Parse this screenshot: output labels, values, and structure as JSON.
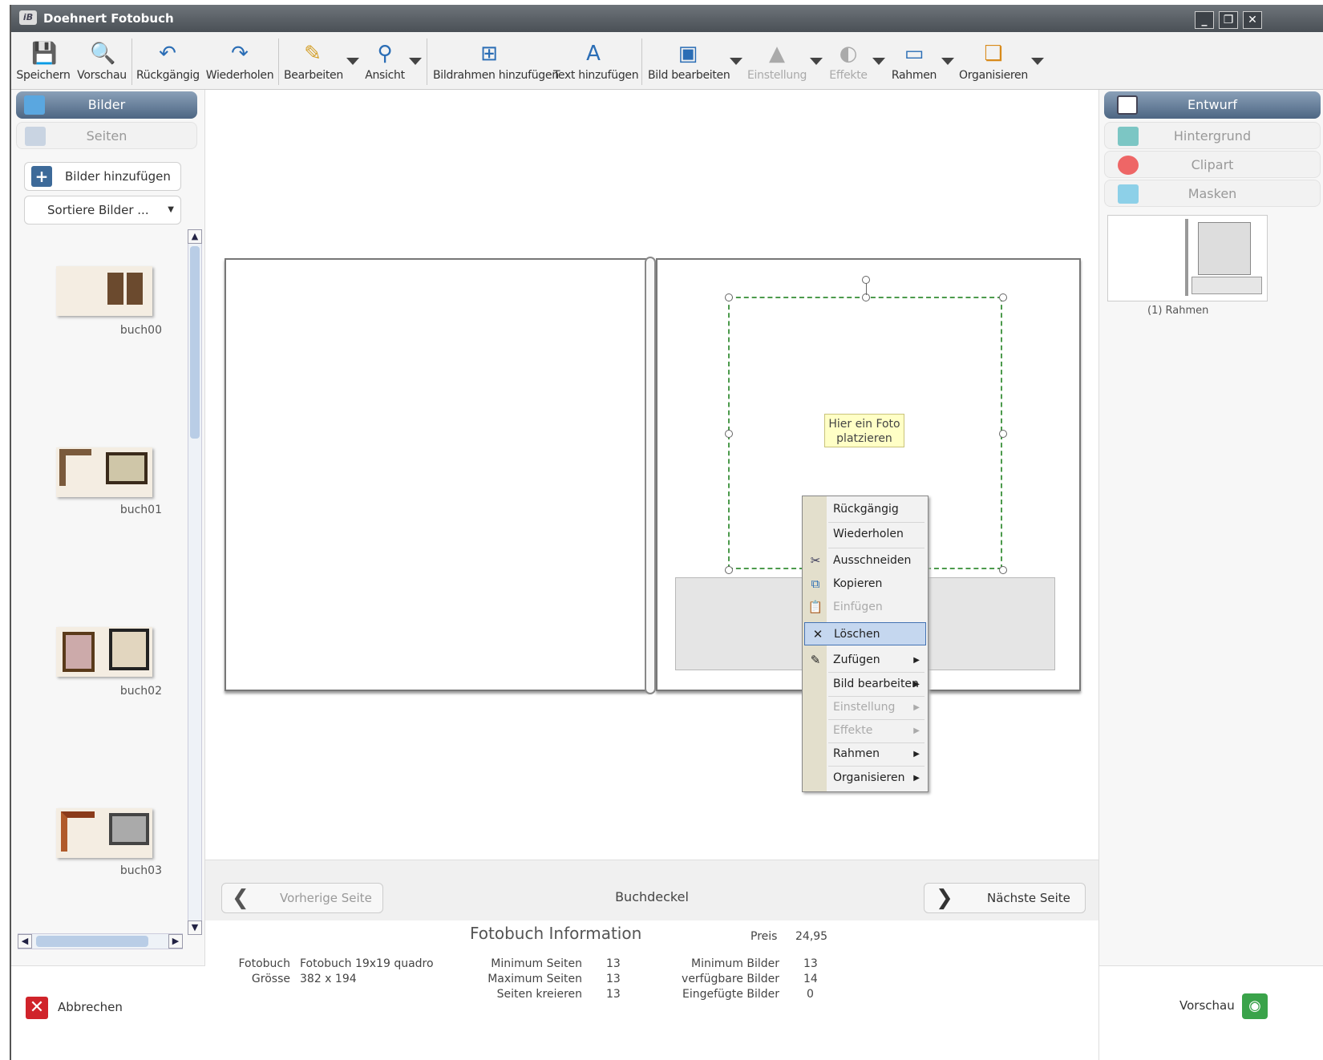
{
  "window": {
    "title": "Doehnert Fotobuch",
    "logo_text": "iB"
  },
  "toolbar": {
    "items": [
      {
        "label": "Speichern",
        "icon": "save-icon"
      },
      {
        "label": "Vorschau",
        "icon": "preview-icon"
      },
      {
        "label": "Rückgängig",
        "icon": "undo-icon"
      },
      {
        "label": "Wiederholen",
        "icon": "redo-icon"
      },
      {
        "label": "Bearbeiten",
        "icon": "brush-icon"
      },
      {
        "label": "Ansicht",
        "icon": "magnifier-icon"
      },
      {
        "label": "Bildrahmen hinzufügen",
        "icon": "add-frame-icon"
      },
      {
        "label": "Text hinzufügen",
        "icon": "add-text-icon"
      },
      {
        "label": "Bild bearbeiten",
        "icon": "edit-image-icon"
      },
      {
        "label": "Einstellung",
        "icon": "adjust-icon",
        "disabled": true
      },
      {
        "label": "Effekte",
        "icon": "effects-icon",
        "disabled": true
      },
      {
        "label": "Rahmen",
        "icon": "frame-icon"
      },
      {
        "label": "Organisieren",
        "icon": "arrange-icon"
      }
    ]
  },
  "left_panel": {
    "tabs": [
      {
        "label": "Bilder",
        "active": true
      },
      {
        "label": "Seiten",
        "active": false
      }
    ],
    "add_button": "Bilder hinzufügen ...",
    "sort_button": "Sortiere Bilder ...",
    "thumbnails": [
      "buch00",
      "buch01",
      "buch02",
      "buch03"
    ],
    "cancel_label": "Abbrechen"
  },
  "canvas": {
    "placeholder": [
      "Hier ein Foto",
      "platzieren"
    ]
  },
  "context_menu": {
    "items": [
      {
        "label": "Rückgängig",
        "icon": "",
        "disabled": false,
        "submenu": false
      },
      {
        "label": "Wiederholen",
        "icon": "",
        "disabled": false,
        "submenu": false
      },
      {
        "label": "Ausschneiden",
        "icon": "scissors-icon",
        "disabled": false,
        "submenu": false
      },
      {
        "label": "Kopieren",
        "icon": "copy-icon",
        "disabled": false,
        "submenu": false
      },
      {
        "label": "Einfügen",
        "icon": "paste-icon",
        "disabled": true,
        "submenu": false
      },
      {
        "label": "Löschen",
        "icon": "delete-icon",
        "disabled": false,
        "submenu": false,
        "highlighted": true
      },
      {
        "label": "Zufügen",
        "icon": "pen-icon",
        "disabled": false,
        "submenu": true
      },
      {
        "label": "Bild bearbeiten",
        "icon": "",
        "disabled": false,
        "submenu": true
      },
      {
        "label": "Einstellung",
        "icon": "",
        "disabled": true,
        "submenu": true
      },
      {
        "label": "Effekte",
        "icon": "",
        "disabled": true,
        "submenu": true
      },
      {
        "label": "Rahmen",
        "icon": "",
        "disabled": false,
        "submenu": true
      },
      {
        "label": "Organisieren",
        "icon": "",
        "disabled": false,
        "submenu": true
      }
    ]
  },
  "nav": {
    "prev": "Vorherige Seite",
    "title": "Buchdeckel",
    "next": "Nächste Seite"
  },
  "info": {
    "heading": "Fotobuch Information",
    "price_label": "Preis",
    "price_value": "24,95",
    "fotobuch_label": "Fotobuch",
    "fotobuch_value": "Fotobuch 19x19 quadro",
    "size_label": "Grösse",
    "size_value": "382 x 194",
    "min_pages_label": "Minimum Seiten",
    "min_pages_value": "13",
    "max_pages_label": "Maximum Seiten",
    "max_pages_value": "13",
    "create_pages_label": "Seiten kreieren",
    "create_pages_value": "13",
    "min_images_label": "Minimum Bilder",
    "min_images_value": "13",
    "avail_images_label": "verfügbare Bilder",
    "avail_images_value": "14",
    "inserted_images_label": "Eingefügte Bilder",
    "inserted_images_value": "0"
  },
  "right_panel": {
    "tabs": [
      {
        "label": "Entwurf",
        "active": true
      },
      {
        "label": "Hintergrund"
      },
      {
        "label": "Clipart"
      },
      {
        "label": "Masken"
      }
    ],
    "layout_caption": "(1) Rahmen",
    "preview_label": "Vorschau"
  }
}
